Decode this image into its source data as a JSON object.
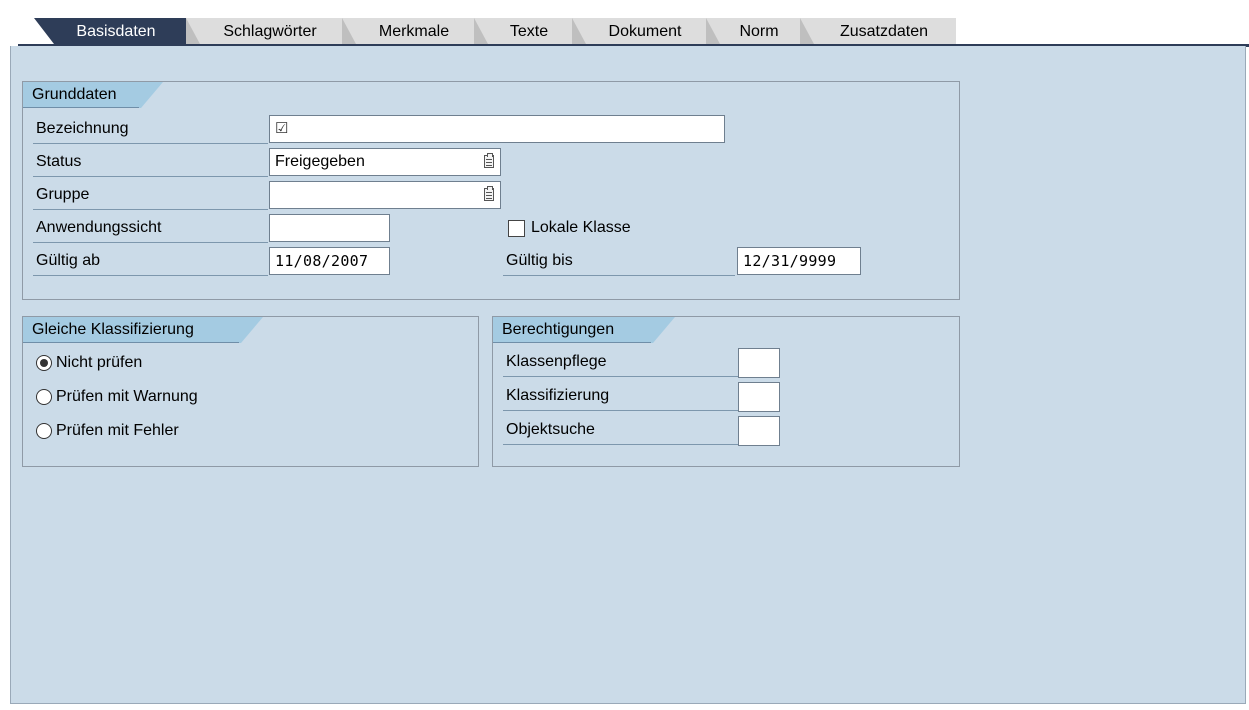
{
  "tabs": [
    {
      "label": "Basisdaten",
      "active": true
    },
    {
      "label": "Schlagwörter",
      "active": false
    },
    {
      "label": "Merkmale",
      "active": false
    },
    {
      "label": "Texte",
      "active": false
    },
    {
      "label": "Dokument",
      "active": false
    },
    {
      "label": "Norm",
      "active": false
    },
    {
      "label": "Zusatzdaten",
      "active": false
    }
  ],
  "grunddaten": {
    "title": "Grunddaten",
    "bezeichnung_label": "Bezeichnung",
    "bezeichnung_value": "",
    "status_label": "Status",
    "status_value": "Freigegeben",
    "gruppe_label": "Gruppe",
    "gruppe_value": "",
    "anwendungssicht_label": "Anwendungssicht",
    "anwendungssicht_value": "",
    "lokale_klasse_label": "Lokale Klasse",
    "lokale_klasse_checked": false,
    "gueltig_ab_label": "Gültig ab",
    "gueltig_ab_value": "11/08/2007",
    "gueltig_bis_label": "Gültig bis",
    "gueltig_bis_value": "12/31/9999"
  },
  "klassifizierung": {
    "title": "Gleiche Klassifizierung",
    "options": [
      {
        "label": "Nicht prüfen",
        "selected": true
      },
      {
        "label": "Prüfen mit Warnung",
        "selected": false
      },
      {
        "label": "Prüfen mit Fehler",
        "selected": false
      }
    ]
  },
  "berechtigungen": {
    "title": "Berechtigungen",
    "klassenpflege_label": "Klassenpflege",
    "klassifizierung_label": "Klassifizierung",
    "objektsuche_label": "Objektsuche",
    "klassenpflege_value": "",
    "klassifizierung_value": "",
    "objektsuche_value": ""
  },
  "icons": {
    "required": "checkbox-required-icon",
    "f4": "value-help-icon"
  }
}
